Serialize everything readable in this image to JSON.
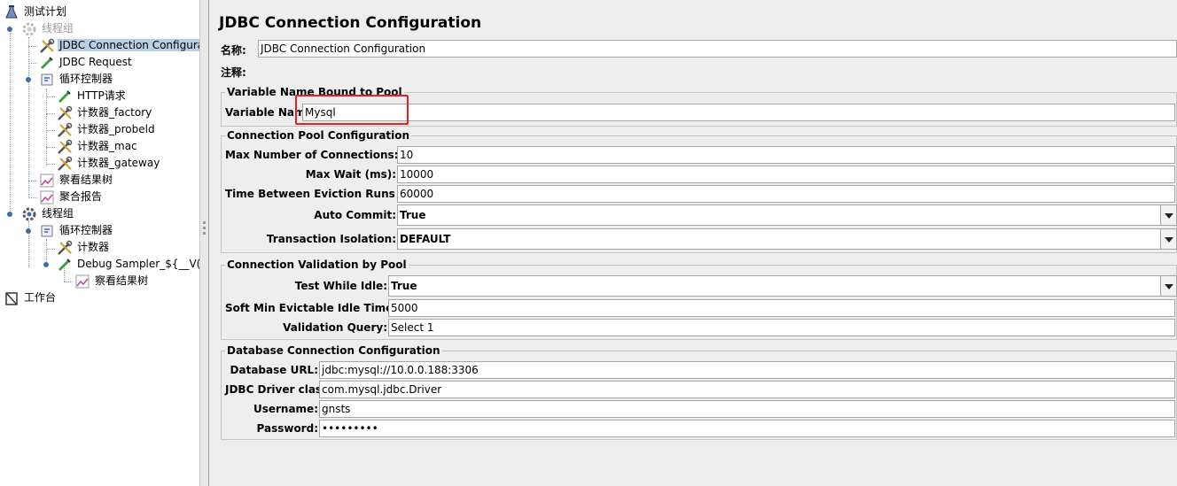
{
  "tree": {
    "nodes": [
      {
        "label": "测试计划",
        "icon": "flask-icon"
      },
      {
        "label": "线程组",
        "icon": "gear-icon",
        "disabled": true
      },
      {
        "label": "JDBC Connection Configurat",
        "icon": "wrench-screwdriver-icon",
        "selected": true
      },
      {
        "label": "JDBC Request",
        "icon": "pipette-icon"
      },
      {
        "label": "循环控制器",
        "icon": "loop-controller-icon"
      },
      {
        "label": "HTTP请求",
        "icon": "pipette-icon"
      },
      {
        "label": "计数器_factory",
        "icon": "wrench-screwdriver-icon"
      },
      {
        "label": "计数器_probeld",
        "icon": "wrench-screwdriver-icon"
      },
      {
        "label": "计数器_mac",
        "icon": "wrench-screwdriver-icon"
      },
      {
        "label": "计数器_gateway",
        "icon": "wrench-screwdriver-icon"
      },
      {
        "label": "察看结果树",
        "icon": "chart-icon"
      },
      {
        "label": "聚合报告",
        "icon": "chart-icon"
      },
      {
        "label": "线程组",
        "icon": "gear-icon"
      },
      {
        "label": "循环控制器",
        "icon": "loop-controller-icon"
      },
      {
        "label": "计数器",
        "icon": "wrench-screwdriver-icon"
      },
      {
        "label": "Debug Sampler_${__V($",
        "icon": "pipette-icon"
      },
      {
        "label": "察看结果树",
        "icon": "chart-icon"
      },
      {
        "label": "工作台",
        "icon": "workbench-icon"
      }
    ]
  },
  "main": {
    "title": "JDBC Connection Configuration",
    "name_label": "名称:",
    "name_value": "JDBC Connection Configuration",
    "comment_label": "注释:",
    "var_group": {
      "title": "Variable Name Bound to Pool",
      "var_label": "Variable Name:",
      "var_value": "Mysql"
    },
    "pool_group": {
      "title": "Connection Pool Configuration",
      "max_conn_label": "Max Number of Connections:",
      "max_conn_value": "10",
      "max_wait_label": "Max Wait (ms):",
      "max_wait_value": "10000",
      "eviction_label": "Time Between Eviction Runs (ms):",
      "eviction_value": "60000",
      "auto_commit_label": "Auto Commit:",
      "auto_commit_value": "True",
      "isolation_label": "Transaction Isolation:",
      "isolation_value": "DEFAULT"
    },
    "validation_group": {
      "title": "Connection Validation by Pool",
      "test_idle_label": "Test While Idle:",
      "test_idle_value": "True",
      "soft_min_label": "Soft Min Evictable Idle Time(ms):",
      "soft_min_value": "5000",
      "query_label": "Validation Query:",
      "query_value": "Select 1"
    },
    "db_group": {
      "title": "Database Connection Configuration",
      "url_label": "Database URL:",
      "url_value": "jdbc:mysql://10.0.0.188:3306",
      "driver_label": "JDBC Driver class:",
      "driver_value": "com.mysql.jdbc.Driver",
      "user_label": "Username:",
      "user_value": "gnsts",
      "pass_label": "Password:",
      "pass_value": "•••••••••"
    }
  },
  "colors": {
    "selection": "#b8cfe5",
    "highlight": "#e62020",
    "panel": "#eeeeee"
  }
}
